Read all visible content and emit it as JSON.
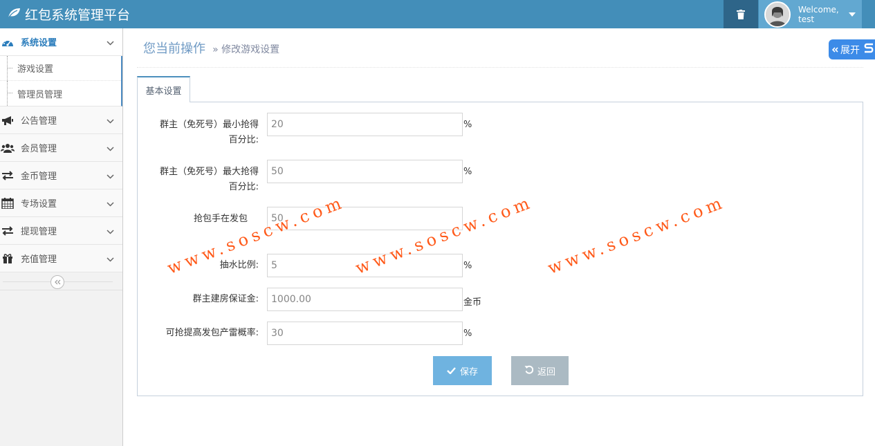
{
  "app": {
    "title": "红包系统管理平台"
  },
  "user": {
    "welcome": "Welcome,",
    "name": "test"
  },
  "sidebar": {
    "items": [
      {
        "label": "系统设置",
        "icon": "dashboard-icon",
        "active": true,
        "children": [
          {
            "label": "游戏设置"
          },
          {
            "label": "管理员管理"
          }
        ]
      },
      {
        "label": "公告管理",
        "icon": "bullhorn-icon"
      },
      {
        "label": "会员管理",
        "icon": "users-icon"
      },
      {
        "label": "金币管理",
        "icon": "exchange-icon"
      },
      {
        "label": "专场设置",
        "icon": "calendar-icon"
      },
      {
        "label": "提现管理",
        "icon": "exchange-icon"
      },
      {
        "label": "充值管理",
        "icon": "gift-icon"
      }
    ],
    "collapse_icon": "double-chevron-left-icon"
  },
  "header": {
    "title": "您当前操作",
    "breadcrumb": "» 修改游戏设置"
  },
  "expand": {
    "label": "展开"
  },
  "tabs": [
    {
      "label": "基本设置"
    }
  ],
  "form": {
    "fields": [
      {
        "label": "群主（免死号）最小抢得百分比:",
        "label_line1": "群主（免死号）最小抢得",
        "label_line2": "百分比:",
        "value": "20",
        "unit": "%"
      },
      {
        "label": "群主（免死号）最大抢得百分比:",
        "label_line1": "群主（免死号）最大抢得",
        "label_line2": "百分比:",
        "value": "50",
        "unit": "%"
      },
      {
        "label_line1": "抢包手在发包",
        "value": "50",
        "unit": ""
      },
      {
        "label": "抽水比例:",
        "value": "5",
        "unit": "%"
      },
      {
        "label": "群主建房保证金:",
        "value": "1000.00",
        "unit": "金币"
      },
      {
        "label": "可抢提高发包产雷概率:",
        "value": "30",
        "unit": "%"
      }
    ],
    "save_label": "保存",
    "back_label": "返回"
  },
  "watermark": {
    "text": "www.soscw.com"
  },
  "colors": {
    "navbar": "#438eb9",
    "accent": "#2b7dbc",
    "save": "#6fb3e0",
    "back": "#abbac3",
    "watermark": "#ff5a1a"
  }
}
